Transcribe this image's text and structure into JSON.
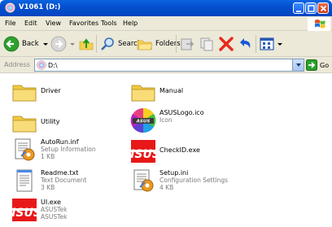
{
  "window": {
    "title": "V1061 (D:)"
  },
  "menu": [
    "File",
    "Edit",
    "View",
    "Favorites",
    "Tools",
    "Help"
  ],
  "toolbar": {
    "back": "Back",
    "search": "Search",
    "folders": "Folders"
  },
  "address": {
    "label": "Address",
    "value": "D:\\",
    "go": "Go"
  },
  "files": [
    {
      "name": "Driver",
      "icon": "folder-icon",
      "lines": []
    },
    {
      "name": "Manual",
      "icon": "folder-icon",
      "lines": []
    },
    {
      "name": "Utility",
      "icon": "folder-icon",
      "lines": []
    },
    {
      "name": "ASUSLogo.ico",
      "icon": "asus-logo-icon",
      "lines": [
        "Icon"
      ]
    },
    {
      "name": "AutoRun.inf",
      "icon": "setup-info-icon",
      "lines": [
        "Setup Information",
        "1 KB"
      ]
    },
    {
      "name": "CheckID.exe",
      "icon": "asus-exe-icon",
      "lines": []
    },
    {
      "name": "Readme.txt",
      "icon": "text-document-icon",
      "lines": [
        "Text Document",
        "3 KB"
      ]
    },
    {
      "name": "Setup.ini",
      "icon": "config-settings-icon",
      "lines": [
        "Configuration Settings",
        "4 KB"
      ]
    },
    {
      "name": "UI.exe",
      "icon": "asus-exe-icon",
      "lines": [
        "ASUSTek",
        "ASUSTek"
      ]
    }
  ]
}
